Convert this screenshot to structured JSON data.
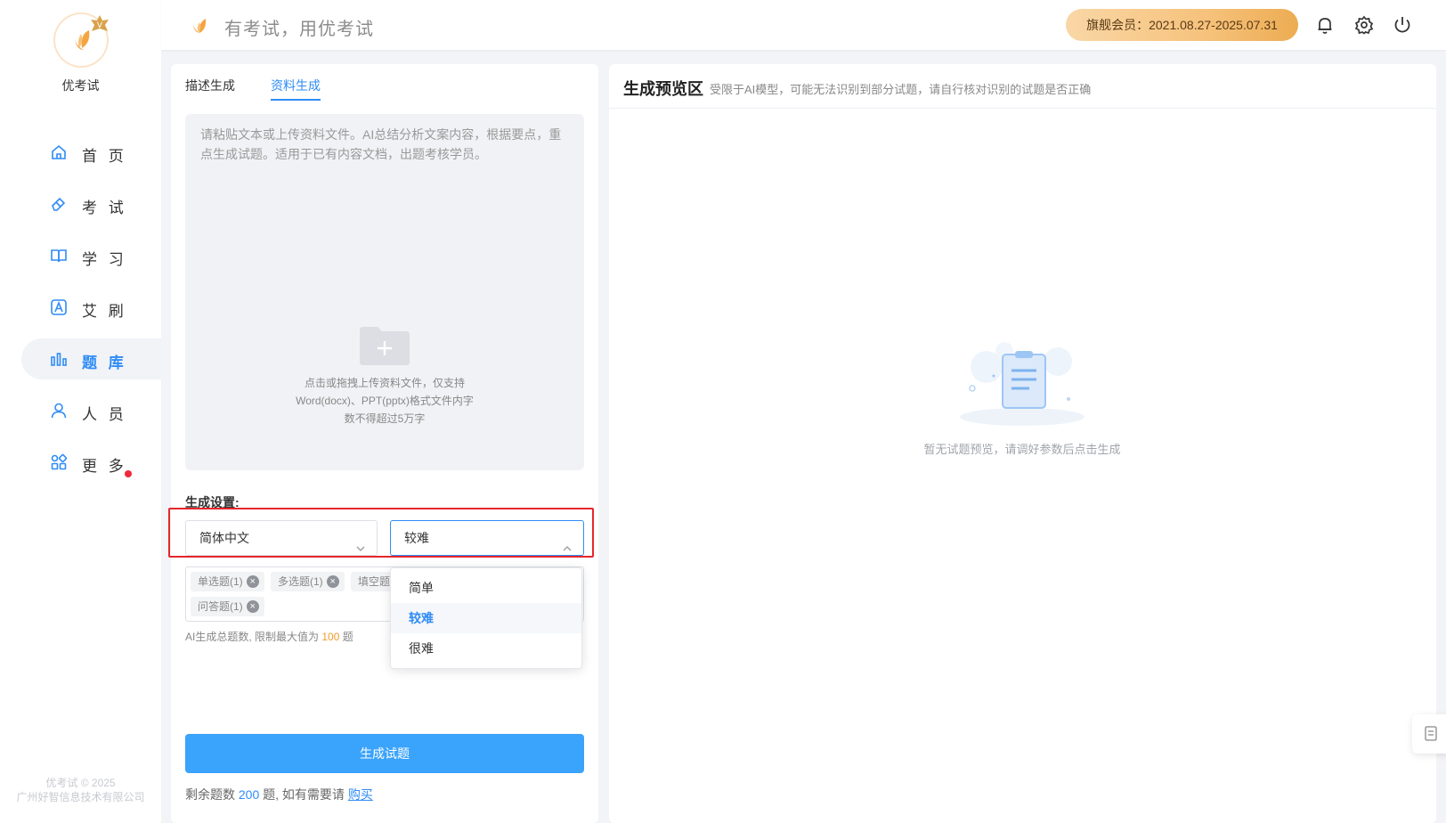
{
  "app": {
    "name": "优考试",
    "slogan": "有考试，用优考试"
  },
  "sidebar": {
    "items": [
      {
        "label": "首 页",
        "icon": "home-icon"
      },
      {
        "label": "考 试",
        "icon": "eraser-icon"
      },
      {
        "label": "学 习",
        "icon": "book-icon"
      },
      {
        "label": "艾 刷",
        "icon": "letter-a-icon"
      },
      {
        "label": "题 库",
        "icon": "bar-chart-icon",
        "active": true
      },
      {
        "label": "人 员",
        "icon": "user-icon"
      },
      {
        "label": "更 多",
        "icon": "apps-icon"
      }
    ],
    "footer": {
      "line1": "优考试 © 2025",
      "line2": "广州好智信息技术有限公司"
    }
  },
  "header": {
    "member_badge": "旗舰会员：2021.08.27-2025.07.31",
    "icons": [
      "bell-icon",
      "gear-icon",
      "power-icon"
    ]
  },
  "left_panel": {
    "tabs": [
      {
        "label": "描述生成"
      },
      {
        "label": "资料生成",
        "active": true
      }
    ],
    "textarea_placeholder": "请粘贴文本或上传资料文件。AI总结分析文案内容，根据要点，重点生成试题。适用于已有内容文档，出题考核学员。",
    "upload_hint": [
      "点击或拖拽上传资料文件，仅支持",
      "Word(docx)、PPT(pptx)格式文件内字",
      "数不得超过5万字"
    ],
    "settings_label": "生成设置:",
    "language_select": "简体中文",
    "difficulty_select": "较难",
    "difficulty_options": [
      "简单",
      "较难",
      "很难"
    ],
    "difficulty_selected_index": 1,
    "tags": [
      "单选题(1)",
      "多选题(1)",
      "填空题",
      "问答题(1)"
    ],
    "limit_note": {
      "prefix": "AI生成总题数, 限制最大值为 ",
      "max": "100",
      "suffix": " 题"
    },
    "generate_button": "生成试题",
    "remaining": {
      "prefix": "剩余题数 ",
      "count": "200",
      "mid": " 题, 如有需要请 ",
      "link": "购买"
    }
  },
  "right_panel": {
    "title": "生成预览区",
    "note": "受限于AI模型，可能无法识别到部分试题，请自行核对识别的试题是否正确",
    "empty_text": "暂无试题预览，请调好参数后点击生成"
  },
  "colors": {
    "accent": "#2f8cf5",
    "button": "#3aa3fb",
    "highlight": "#e5262b",
    "dot": "#f0283c"
  }
}
